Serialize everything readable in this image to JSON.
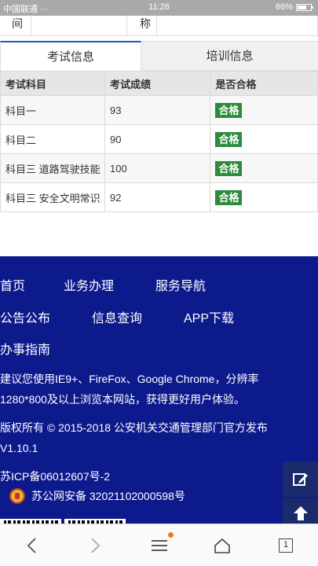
{
  "status_bar": {
    "carrier": "中国联通 ···",
    "time": "11:26",
    "battery": "66%"
  },
  "info_top": {
    "label_1": "间",
    "label_2": "称"
  },
  "tabs": [
    {
      "label": "考试信息",
      "active": true
    },
    {
      "label": "培训信息",
      "active": false
    }
  ],
  "table": {
    "headers": [
      "考试科目",
      "考试成绩",
      "是否合格"
    ],
    "rows": [
      {
        "subject": "科目一",
        "score": "93",
        "result": "合格"
      },
      {
        "subject": "科目二",
        "score": "90",
        "result": "合格"
      },
      {
        "subject": "科目三 道路驾驶技能",
        "score": "100",
        "result": "合格"
      },
      {
        "subject": "科目三 安全文明常识",
        "score": "92",
        "result": "合格"
      }
    ]
  },
  "footer": {
    "nav_row_1": [
      "首页",
      "业务办理",
      "服务导航"
    ],
    "nav_row_2": [
      "公告公布",
      "信息查询",
      "APP下载"
    ],
    "nav_row_3": [
      "办事指南"
    ],
    "advice_line_1": "建议您使用IE9+、FireFox、Google Chrome，分辨率",
    "advice_line_2": "1280*800及以上浏览本网站，获得更好用户体验。",
    "copyright_line_1": "版权所有 © 2015-2018 公安机关交通管理部门官方发布",
    "copyright_line_2": "V1.10.1",
    "icp": "苏ICP备06012607号-2",
    "police_record": "苏公网安备 32021102000598号"
  },
  "browser_bar": {
    "tab_count": "1"
  },
  "colors": {
    "footer_bg": "#0d1a8c",
    "tab_accent": "#1e56c3",
    "pass_badge": "#2e8b3d",
    "float_btn": "#1b2a6b"
  }
}
